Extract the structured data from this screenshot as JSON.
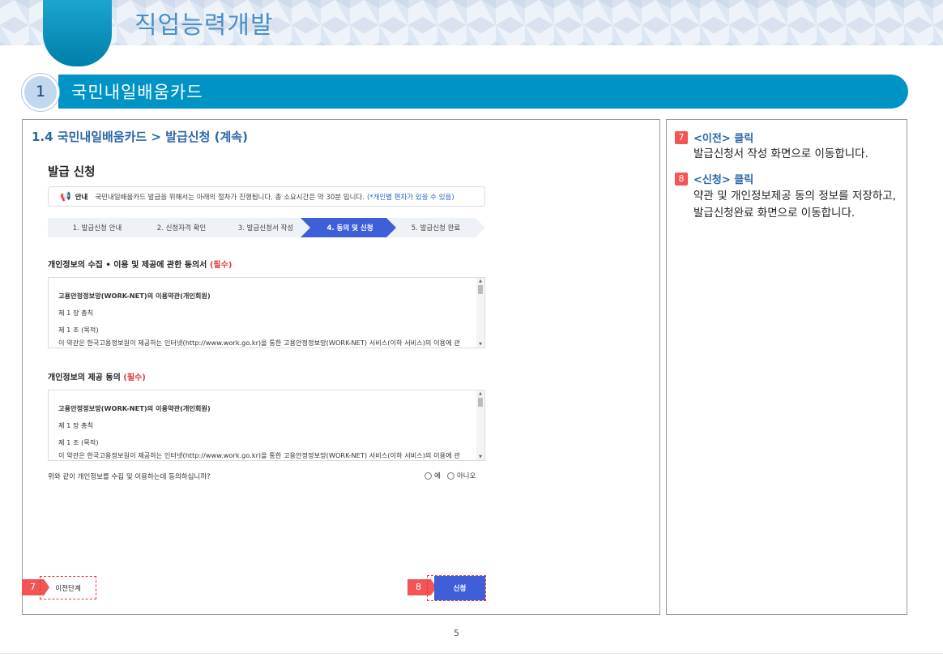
{
  "header": {
    "title": "직업능력개발"
  },
  "section": {
    "number": "1",
    "title": "국민내일배움카드"
  },
  "panel_title": "1.4 국민내일배움카드 > 발급신청 (계속)",
  "screenshot": {
    "heading": "발급 신청",
    "notice": {
      "label": "안내",
      "text": "국민내일배움카드 발급을 위해서는 아래의 절차가 진행됩니다. 총 소요시간은 약 30분 입니다.",
      "highlight": "(*개인별 편차가 있을 수 있음)"
    },
    "steps": [
      {
        "label": "1. 발급신청 안내"
      },
      {
        "label": "2. 신청자격 확인"
      },
      {
        "label": "3. 발급신청서 작성"
      },
      {
        "label": "4. 동의 및 신청"
      },
      {
        "label": "5. 발급신청 완료"
      }
    ],
    "agreement1": {
      "title": "개인정보의 수집 • 이용 및 제공에 관한 동의서",
      "required": "(필수)",
      "terms": {
        "line1": "고용안정정보망(WORK-NET)의 이용약관(개인회원)",
        "line2": "제 1 장 총칙",
        "line3": "제 1 조 (목적)",
        "line4": "이 약관은 한국고용정보원이 제공하는 인터넷(http://www.work.go.kr)을 통한 고용안정정보망(WORK-NET) 서비스(이하 서비스)의 이용에 관"
      }
    },
    "agreement2": {
      "title": "개인정보의 제공 동의",
      "required": "(필수)",
      "terms": {
        "line1": "고용안정정보망(WORK-NET)의 이용약관(개인회원)",
        "line2": "제 1 장 총칙",
        "line3": "제 1 조 (목적)",
        "line4": "이 약관은 한국고용정보원이 제공하는 인터넷(http://www.work.go.kr)을 통한 고용안정정보망(WORK-NET) 서비스(이하 서비스)의 이용에 관"
      }
    },
    "question": "위와 같이 개인정보를 수집 및 이용하는데 동의하십니까?",
    "radio_yes": "예",
    "radio_no": "아니오",
    "prev_button": "이전단계",
    "submit_button": "신청",
    "marker_prev": "7",
    "marker_submit": "8"
  },
  "page_number": "5",
  "instructions": [
    {
      "number": "7",
      "heading": "<이전> 클릭",
      "desc": "발급신청서 작성 화면으로 이동합니다."
    },
    {
      "number": "8",
      "heading": "<신청> 클릭",
      "desc": "약관 및 개인정보제공 동의 정보를 저장하고, 발급신청완료 화면으로 이동합니다."
    }
  ],
  "colors": {
    "accent": "#0094c6",
    "title_blue": "#2b66a8",
    "step_active": "#3f5fd9",
    "marker_red": "#f25555"
  }
}
